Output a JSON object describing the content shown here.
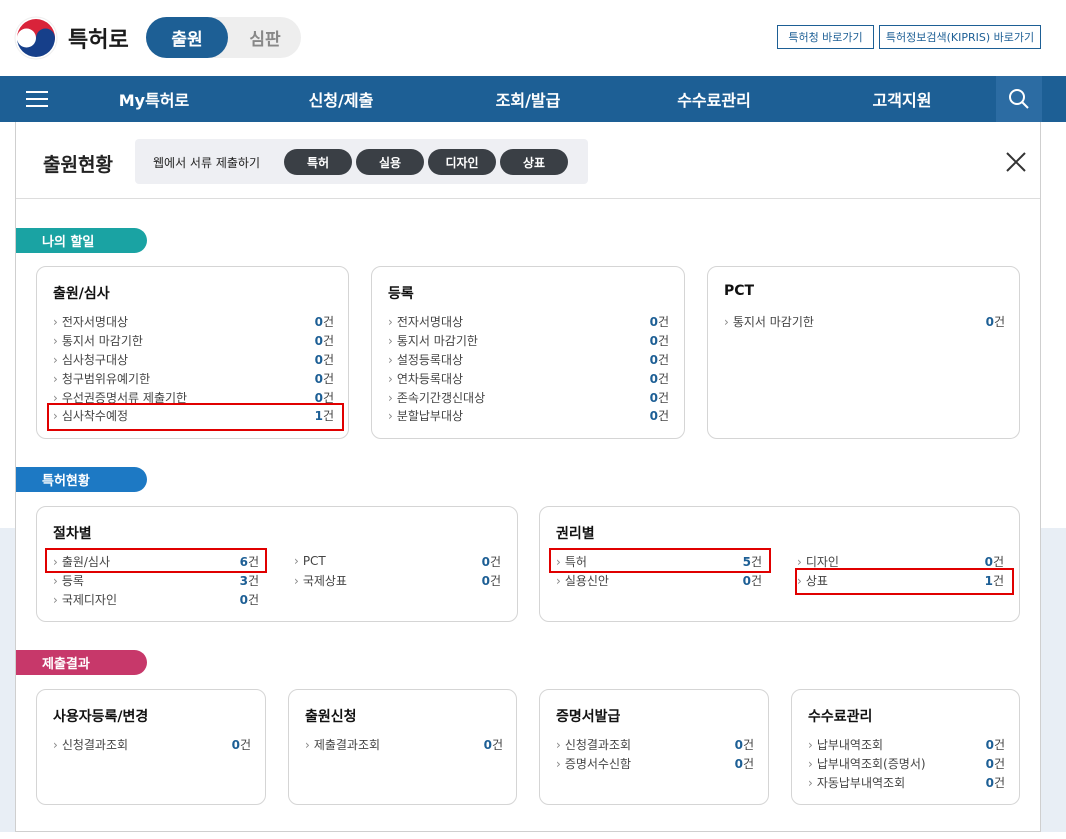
{
  "header": {
    "brand": "특허로",
    "mode_active": "출원",
    "mode_inactive": "심판",
    "ext_links": [
      "특허청 바로가기",
      "특허정보검색(KIPRIS) 바로가기"
    ]
  },
  "nav": {
    "items": [
      "My특허로",
      "신청/제출",
      "조회/발급",
      "수수료관리",
      "고객지원"
    ],
    "menu_icon": "hamburger-icon",
    "search_icon": "search-icon"
  },
  "panel": {
    "title": "출원현황",
    "quick_label": "웹에서 서류 제출하기",
    "quick_buttons": [
      "특허",
      "실용",
      "디자인",
      "상표"
    ],
    "close_icon": "close-icon"
  },
  "sections": {
    "todo": {
      "tag": "나의 할일",
      "color": "#1aa3a3",
      "cards": [
        {
          "title": "출원/심사",
          "rows": [
            {
              "label": "전자서명대상",
              "count": "0",
              "unit": "건"
            },
            {
              "label": "통지서 마감기한",
              "count": "0",
              "unit": "건"
            },
            {
              "label": "심사청구대상",
              "count": "0",
              "unit": "건"
            },
            {
              "label": "청구범위유예기한",
              "count": "0",
              "unit": "건"
            },
            {
              "label": "우선권증명서류 제출기한",
              "count": "0",
              "unit": "건"
            },
            {
              "label": "심사착수예정",
              "count": "1",
              "unit": "건"
            }
          ]
        },
        {
          "title": "등록",
          "rows": [
            {
              "label": "전자서명대상",
              "count": "0",
              "unit": "건"
            },
            {
              "label": "통지서 마감기한",
              "count": "0",
              "unit": "건"
            },
            {
              "label": "설정등록대상",
              "count": "0",
              "unit": "건"
            },
            {
              "label": "연차등록대상",
              "count": "0",
              "unit": "건"
            },
            {
              "label": "존속기간갱신대상",
              "count": "0",
              "unit": "건"
            },
            {
              "label": "분할납부대상",
              "count": "0",
              "unit": "건"
            }
          ]
        },
        {
          "title": "PCT",
          "rows": [
            {
              "label": "통지서 마감기한",
              "count": "0",
              "unit": "건"
            }
          ]
        }
      ]
    },
    "status": {
      "tag": "특허현황",
      "color": "#1d79c4",
      "cards": [
        {
          "title": "절차별",
          "col1": [
            {
              "label": "출원/심사",
              "count": "6",
              "unit": "건"
            },
            {
              "label": "등록",
              "count": "3",
              "unit": "건"
            },
            {
              "label": "국제디자인",
              "count": "0",
              "unit": "건"
            }
          ],
          "col2": [
            {
              "label": "PCT",
              "count": "0",
              "unit": "건"
            },
            {
              "label": "국제상표",
              "count": "0",
              "unit": "건"
            }
          ]
        },
        {
          "title": "권리별",
          "col1": [
            {
              "label": "특허",
              "count": "5",
              "unit": "건"
            },
            {
              "label": "실용신안",
              "count": "0",
              "unit": "건"
            }
          ],
          "col2": [
            {
              "label": "디자인",
              "count": "0",
              "unit": "건"
            },
            {
              "label": "상표",
              "count": "1",
              "unit": "건"
            }
          ]
        }
      ]
    },
    "results": {
      "tag": "제출결과",
      "color": "#c7386a",
      "cards": [
        {
          "title": "사용자등록/변경",
          "rows": [
            {
              "label": "신청결과조회",
              "count": "0",
              "unit": "건"
            }
          ]
        },
        {
          "title": "출원신청",
          "rows": [
            {
              "label": "제출결과조회",
              "count": "0",
              "unit": "건"
            }
          ]
        },
        {
          "title": "증명서발급",
          "rows": [
            {
              "label": "신청결과조회",
              "count": "0",
              "unit": "건"
            },
            {
              "label": "증명서수신함",
              "count": "0",
              "unit": "건"
            }
          ]
        },
        {
          "title": "수수료관리",
          "rows": [
            {
              "label": "납부내역조회",
              "count": "0",
              "unit": "건"
            },
            {
              "label": "납부내역조회(증명서)",
              "count": "0",
              "unit": "건"
            },
            {
              "label": "자동납부내역조회",
              "count": "0",
              "unit": "건"
            }
          ]
        }
      ]
    }
  }
}
